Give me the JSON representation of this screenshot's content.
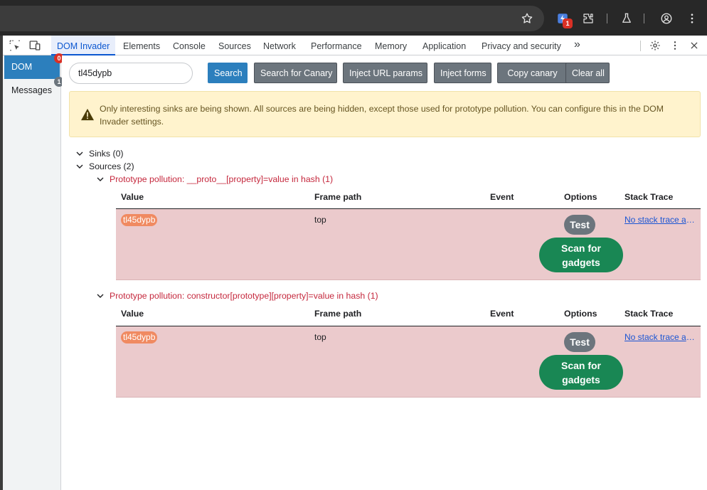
{
  "browser": {
    "extension_badge": "1"
  },
  "devtools": {
    "tabs": [
      {
        "label": "DOM Invader"
      },
      {
        "label": "Elements"
      },
      {
        "label": "Console"
      },
      {
        "label": "Sources"
      },
      {
        "label": "Network"
      },
      {
        "label": "Performance"
      },
      {
        "label": "Memory"
      },
      {
        "label": "Application"
      },
      {
        "label": "Privacy and security"
      }
    ],
    "more_tabs": "»"
  },
  "sidebar": {
    "items": [
      {
        "label": "DOM",
        "badge": "0",
        "badge_color": "#d93025"
      },
      {
        "label": "Messages",
        "badge": "1",
        "badge_color": "#6c757d"
      }
    ]
  },
  "toolbar": {
    "search_value": "tl45dypb",
    "search_label": "Search",
    "canary_label": "Search for Canary",
    "inject_url_label": "Inject URL params",
    "inject_forms_label": "Inject forms",
    "copy_canary_label": "Copy canary",
    "clear_label": "Clear all"
  },
  "alert": {
    "text": "Only interesting sinks are being shown. All sources are being hidden, except those used for prototype pollution. You can configure this in the DOM Invader settings."
  },
  "tree": {
    "sinks_label": "Sinks (0)",
    "sources_label": "Sources (2)"
  },
  "columns": {
    "value": "Value",
    "frame_path": "Frame path",
    "event": "Event",
    "options": "Options",
    "stack_trace": "Stack Trace"
  },
  "sources": [
    {
      "title": "Prototype pollution: __proto__[property]=value in hash (1)",
      "value": "tl45dypb",
      "frame_path": "top",
      "event": "",
      "test_label": "Test",
      "scan_label": "Scan for gadgets",
      "stack_link": "No stack trace available"
    },
    {
      "title": "Prototype pollution: constructor[prototype][property]=value in hash (1)",
      "value": "tl45dypb",
      "frame_path": "top",
      "event": "",
      "test_label": "Test",
      "scan_label": "Scan for gadgets",
      "stack_link": "No stack trace available"
    }
  ],
  "colors": {
    "accent": "#2c7fbd",
    "row_bg": "#ebcacc",
    "canary_pill": "#f08a61",
    "scan_green": "#198754",
    "source_red": "#c5283d"
  }
}
